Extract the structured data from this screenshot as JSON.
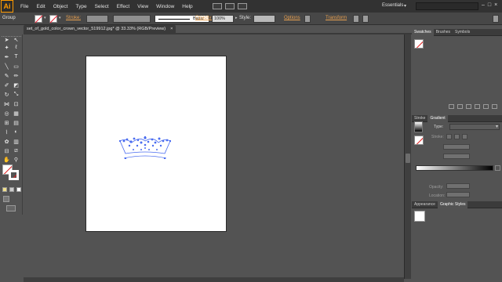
{
  "app": {
    "logo": "Ai",
    "menu": [
      "File",
      "Edit",
      "Object",
      "Type",
      "Select",
      "Effect",
      "View",
      "Window",
      "Help"
    ],
    "workspace": "Essentials",
    "window_buttons": [
      "–",
      "□",
      "×"
    ]
  },
  "control_bar": {
    "selection_label": "Group",
    "stroke_label": "Stroke:",
    "brush_label": "Basic",
    "opacity_label": "Opacity:",
    "opacity_value": "100%",
    "style_label": "Style:",
    "options_label": "Options",
    "transform_label": "Transform"
  },
  "document": {
    "tab_title": "set_of_gold_color_crown_vector_519912.jpg* @ 33.33% (RGB/Preview)",
    "close_glyph": "×"
  },
  "right_panels": {
    "top_tabs": [
      "Swatches",
      "Brushes",
      "Symbols"
    ],
    "mid_tabs": [
      "Stroke",
      "Gradient"
    ],
    "gradient": {
      "type_label": "Type:",
      "stroke_label": "Stroke:",
      "opacity_label": "Opacity:",
      "location_label": "Location:"
    },
    "bottom_tabs": [
      "Appearance",
      "Graphic Styles"
    ]
  },
  "colors": {
    "accent_orange": "#e8a050",
    "selection_blue": "#4a6cf0",
    "no_fill_red": "#e02020"
  }
}
